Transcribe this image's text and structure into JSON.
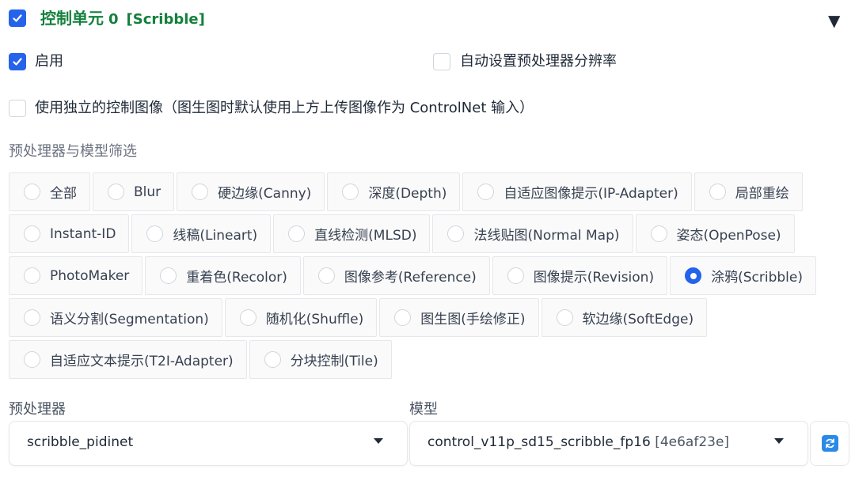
{
  "header": {
    "title": "控制单元",
    "unit_index": "0",
    "tag": "[Scribble]",
    "checked": true,
    "collapse_glyph": "▼"
  },
  "options": {
    "enable_label": "启用",
    "enable_checked": true,
    "auto_resolution_label": "自动设置预处理器分辨率",
    "auto_resolution_checked": false,
    "separate_image_label": "使用独立的控制图像（图生图时默认使用上方上传图像作为 ControlNet 输入）",
    "separate_image_checked": false
  },
  "filter": {
    "label": "预处理器与模型筛选",
    "selected": "涂鸦(Scribble)",
    "rows": [
      [
        "全部",
        "Blur",
        "硬边缘(Canny)",
        "深度(Depth)",
        "自适应图像提示(IP-Adapter)",
        "局部重绘"
      ],
      [
        "Instant-ID",
        "线稿(Lineart)",
        "直线检测(MLSD)",
        "法线贴图(Normal Map)",
        "姿态(OpenPose)"
      ],
      [
        "PhotoMaker",
        "重着色(Recolor)",
        "图像参考(Reference)",
        "图像提示(Revision)",
        "涂鸦(Scribble)"
      ],
      [
        "语义分割(Segmentation)",
        "随机化(Shuffle)",
        "图生图(手绘修正)",
        "软边缘(SoftEdge)"
      ],
      [
        "自适应文本提示(T2I-Adapter)",
        "分块控制(Tile)"
      ]
    ]
  },
  "preprocessor": {
    "label": "预处理器",
    "value": "scribble_pidinet"
  },
  "model": {
    "label": "模型",
    "value": "control_v11p_sd15_scribble_fp16",
    "hash": "[4e6af23e]"
  },
  "colors": {
    "accent": "#2563eb",
    "title_green": "#15803d",
    "refresh_blue": "#2b8ae8"
  },
  "icons": {
    "collapse": "triangle-down-icon",
    "refresh": "refresh-icon",
    "dropdown": "caret-down-icon"
  }
}
